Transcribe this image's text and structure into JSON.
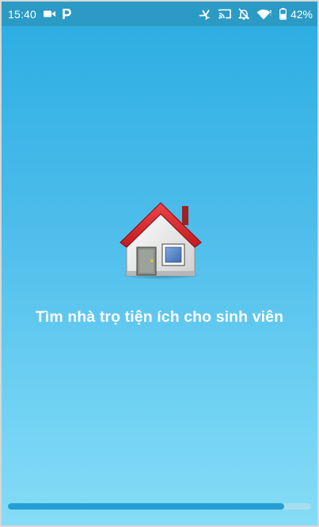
{
  "status_bar": {
    "time": "15:40",
    "battery_percent": "42%",
    "icons": [
      "video-camera-icon",
      "parking-p-icon",
      "airplane-notification-icon",
      "cast-icon",
      "notifications-off-icon",
      "wifi-icon",
      "battery-icon"
    ]
  },
  "splash": {
    "tagline": "Tìm nhà trọ tiện ích cho sinh viên",
    "logo_icon": "house-icon"
  },
  "progress": {
    "fraction": 0.91
  },
  "colors": {
    "status_bar": "#2b9bc5",
    "background_top": "#2eaee3",
    "background_bottom": "#85dcf6",
    "progress_fill": "#259fd2",
    "progress_track": "#a6ddf1",
    "roof_red": "#d8242a"
  }
}
